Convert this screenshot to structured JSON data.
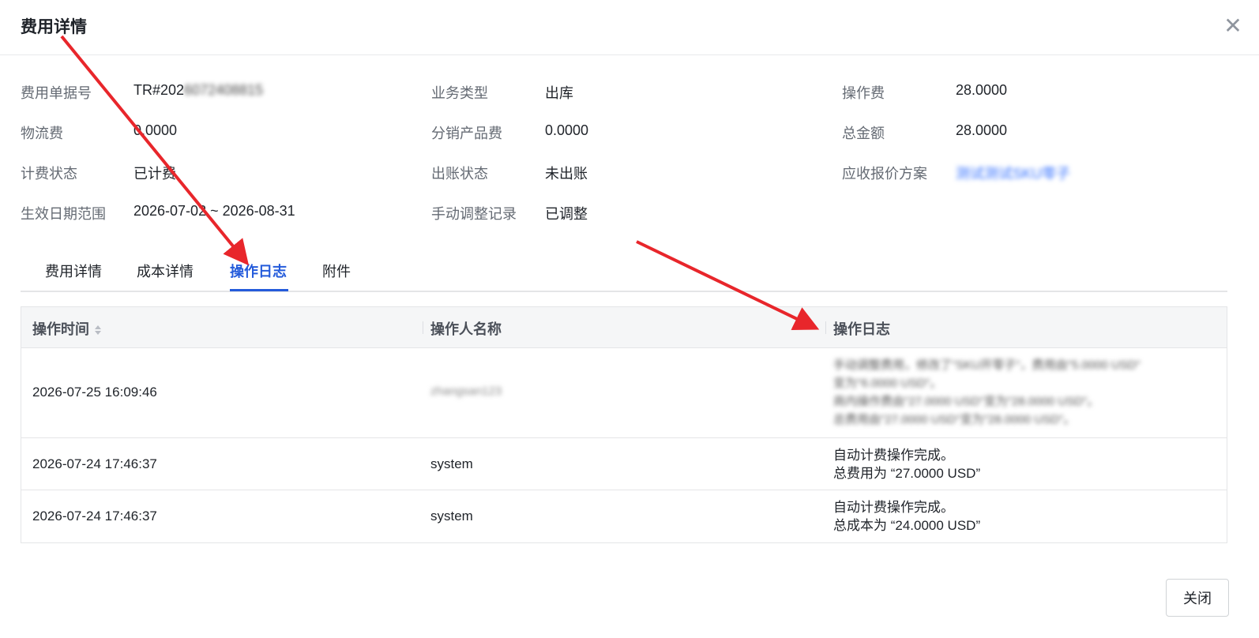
{
  "dialog": {
    "title": "费用详情"
  },
  "info": {
    "bill_no_label": "费用单据号",
    "bill_no_value": "TR#202",
    "bill_no_blurred": "6072408815",
    "biz_type_label": "业务类型",
    "biz_type_value": "出库",
    "op_fee_label": "操作费",
    "op_fee_value": "28.0000",
    "logistics_label": "物流费",
    "logistics_value": "0.0000",
    "dist_fee_label": "分销产品费",
    "dist_fee_value": "0.0000",
    "total_label": "总金额",
    "total_value": "28.0000",
    "billing_status_label": "计费状态",
    "billing_status_value": "已计费",
    "account_status_label": "出账状态",
    "account_status_value": "未出账",
    "quote_plan_label": "应收报价方案",
    "quote_plan_value": "测试测试SKU零子",
    "date_range_label": "生效日期范围",
    "date_range_value": "2026-07-02 ~ 2026-08-31",
    "manual_adjust_label": "手动调整记录",
    "manual_adjust_value": "已调整"
  },
  "tabs": [
    {
      "label": "费用详情"
    },
    {
      "label": "成本详情"
    },
    {
      "label": "操作日志"
    },
    {
      "label": "附件"
    }
  ],
  "table": {
    "headers": {
      "time": "操作时间",
      "operator": "操作人名称",
      "log": "操作日志"
    },
    "rows": [
      {
        "time": "2026-07-25 16:09:46",
        "operator": "zhangsan123",
        "log": [
          "手动调整费用，修改了\"SKU开零子\"，费用由\"5.0000 USD\"",
          "变为\"6.0000 USD\"。",
          "商内操作费由\"27.0000 USD\"变为\"28.0000 USD\"。",
          "总费用由\"27.0000 USD\"变为\"28.0000 USD\"。"
        ]
      },
      {
        "time": "2026-07-24 17:46:37",
        "operator": "system",
        "log": [
          "自动计费操作完成。",
          "总费用为 “27.0000 USD”"
        ]
      },
      {
        "time": "2026-07-24 17:46:37",
        "operator": "system",
        "log": [
          "自动计费操作完成。",
          "总成本为 “24.0000 USD”"
        ]
      }
    ]
  },
  "footer": {
    "close_label": "关闭"
  },
  "colors": {
    "accent": "#245bdb",
    "annotation_arrow": "#e8262b"
  }
}
